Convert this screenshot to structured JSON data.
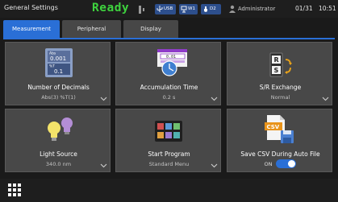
{
  "status_bar": {
    "title": "General Settings",
    "state": "Ready",
    "usb_label": "USB",
    "wifi_label": "W1",
    "drive_label": "D2",
    "user": "Administrator",
    "date": "01/31",
    "time": "10:51",
    "colors": {
      "ready": "#3ed23e",
      "pill": "#2d4f8d"
    }
  },
  "tabs": [
    {
      "label": "Measurement",
      "active": true
    },
    {
      "label": "Peripheral",
      "active": false
    },
    {
      "label": "Display",
      "active": false
    }
  ],
  "tiles": {
    "decimals": {
      "label": "Number of Decimals",
      "value": "Abs(3) %T(1)",
      "icon": "decimals-icon",
      "icon_text": {
        "abs": "Abs",
        "abs_value": "0.001",
        "t": "%T",
        "t_value": "0.1"
      }
    },
    "accumulation": {
      "label": "Accumulation Time",
      "value": "0.2 s",
      "icon": "accumulation-time-icon",
      "icon_text": "0.01"
    },
    "sr_exchange": {
      "label": "S/R Exchange",
      "value": "Normal",
      "icon": "sr-exchange-icon",
      "icon_text": {
        "r": "R",
        "s": "S"
      }
    },
    "light_source": {
      "label": "Light Source",
      "value": "340.0 nm",
      "icon": "light-bulbs-icon"
    },
    "start_program": {
      "label": "Start Program",
      "value": "Standard Menu",
      "icon": "program-grid-icon"
    },
    "save_csv": {
      "label": "Save CSV During Auto File",
      "toggle_text": "ON",
      "toggle_on": true,
      "icon": "csv-save-icon",
      "icon_text": "CSV"
    }
  },
  "accent_color": "#2a6fd6"
}
